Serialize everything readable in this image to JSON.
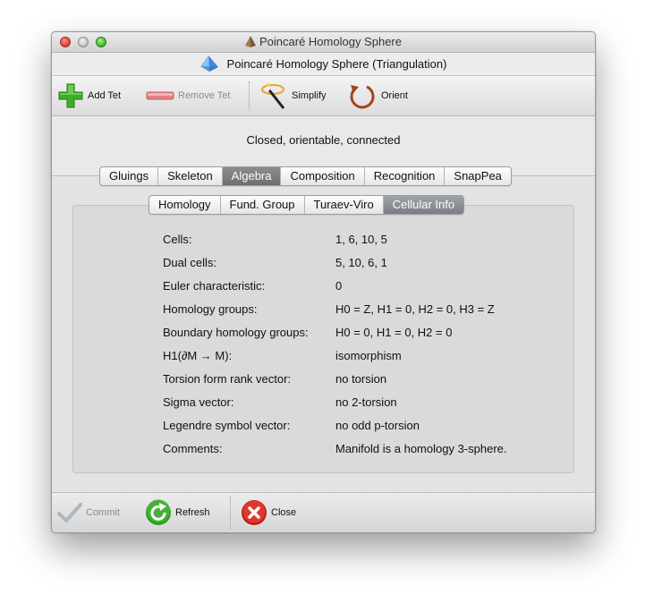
{
  "window": {
    "title": "Poincaré Homology Sphere",
    "subtitle": "Poincaré Homology Sphere (Triangulation)"
  },
  "toolbar": {
    "add_tet": "Add Tet",
    "remove_tet": "Remove Tet",
    "simplify": "Simplify",
    "orient": "Orient"
  },
  "status": "Closed, orientable, connected",
  "main_tabs": [
    "Gluings",
    "Skeleton",
    "Algebra",
    "Composition",
    "Recognition",
    "SnapPea"
  ],
  "main_tab_active": "Algebra",
  "sub_tabs": [
    "Homology",
    "Fund. Group",
    "Turaev-Viro",
    "Cellular Info"
  ],
  "sub_tab_active": "Cellular Info",
  "cellular_info": [
    {
      "label": "Cells:",
      "value": "1, 6, 10, 5"
    },
    {
      "label": "Dual cells:",
      "value": "5, 10, 6, 1"
    },
    {
      "label": "Euler characteristic:",
      "value": "0"
    },
    {
      "label": "Homology groups:",
      "value": "H0 = Z,  H1 = 0,  H2 = 0,  H3 = Z"
    },
    {
      "label": "Boundary homology groups:",
      "value": "H0 = 0,  H1 = 0,  H2 = 0"
    },
    {
      "label": "H1(∂M → M):",
      "value": "isomorphism"
    },
    {
      "label": "Torsion form rank vector:",
      "value": "no torsion"
    },
    {
      "label": "Sigma vector:",
      "value": "no 2-torsion"
    },
    {
      "label": "Legendre symbol vector:",
      "value": "no odd p-torsion"
    },
    {
      "label": "Comments:",
      "value": "Manifold is a homology 3-sphere."
    }
  ],
  "bottombar": {
    "commit": "Commit",
    "refresh": "Refresh",
    "close": "Close"
  },
  "colors": {
    "active_tab": "#7a7a7a",
    "active_subtab": "#8a8e94",
    "add_icon": "#3fae2a",
    "remove_icon": "#e06b6b",
    "close_icon": "#d62a20",
    "refresh_icon": "#2e9a22"
  }
}
